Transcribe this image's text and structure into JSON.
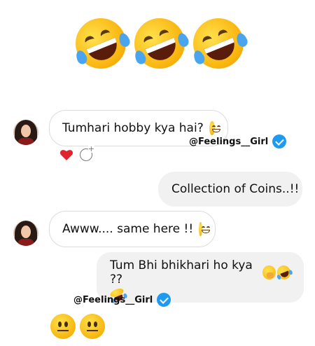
{
  "header": {
    "reaction_icons": [
      "rolling-on-the-floor-laughing-icon",
      "rolling-on-the-floor-laughing-icon",
      "rolling-on-the-floor-laughing-icon"
    ]
  },
  "messages": [
    {
      "direction": "incoming",
      "text": "Tumhari hobby kya hai?",
      "emoji": "grinning-face-icon",
      "reaction": "red-heart-icon",
      "reaction_action": "add-reaction-icon"
    },
    {
      "direction": "outgoing",
      "text": "Collection of Coins..!!"
    },
    {
      "direction": "incoming",
      "text": "Awww.... same here !!",
      "emoji": "grinning-face-icon"
    },
    {
      "direction": "outgoing",
      "text": "Tum Bhi bhikhari ho kya ??",
      "emojis": [
        "face-with-hand-over-mouth-icon",
        "rolling-on-the-floor-laughing-icon",
        "rolling-on-the-floor-laughing-icon"
      ]
    }
  ],
  "watermarks": [
    {
      "handle": "@Feelings__Girl",
      "badge": "verified-badge-icon"
    },
    {
      "handle": "@Feelings__Girl",
      "badge": "verified-badge-icon"
    }
  ],
  "footer": {
    "emojis": [
      "neutral-face-icon",
      "neutral-face-icon"
    ]
  },
  "colors": {
    "incoming_bubble_bg": "#ffffff",
    "outgoing_bubble_bg": "#f1f1f1",
    "verified_blue": "#1d9bf0",
    "heart_red": "#e0242e"
  }
}
